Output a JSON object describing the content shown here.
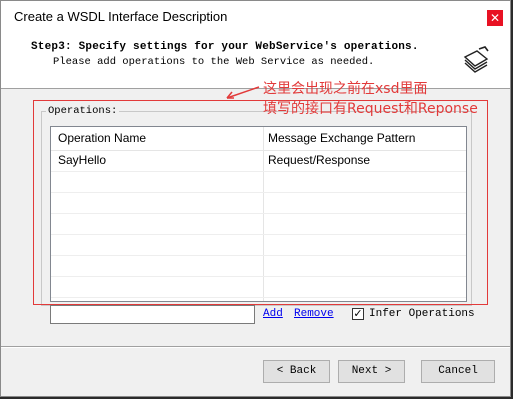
{
  "window": {
    "title": "Create a WSDL Interface Description",
    "close_glyph": "✕"
  },
  "header": {
    "step_title": "Step3: Specify settings for your WebService's operations.",
    "step_subtitle": "Please add operations to the Web Service as needed.",
    "icon": "wizard-document-icon"
  },
  "operations": {
    "group_label": "Operations:",
    "columns": [
      "Operation Name",
      "Message Exchange Pattern"
    ],
    "rows": [
      {
        "name": "SayHello",
        "pattern": "Request/Response"
      }
    ]
  },
  "annotation": {
    "line1": "这里会出现之前在xsd里面",
    "line2": "填写的接口有Request和Reponse",
    "color": "#e23a3a"
  },
  "controls": {
    "input_value": "",
    "add_label": "Add",
    "remove_label": "Remove",
    "infer_label": "Infer Operations",
    "infer_checked": true,
    "check_glyph": "✓"
  },
  "buttons": {
    "back": "< Back",
    "next": "Next >",
    "cancel": "Cancel"
  }
}
